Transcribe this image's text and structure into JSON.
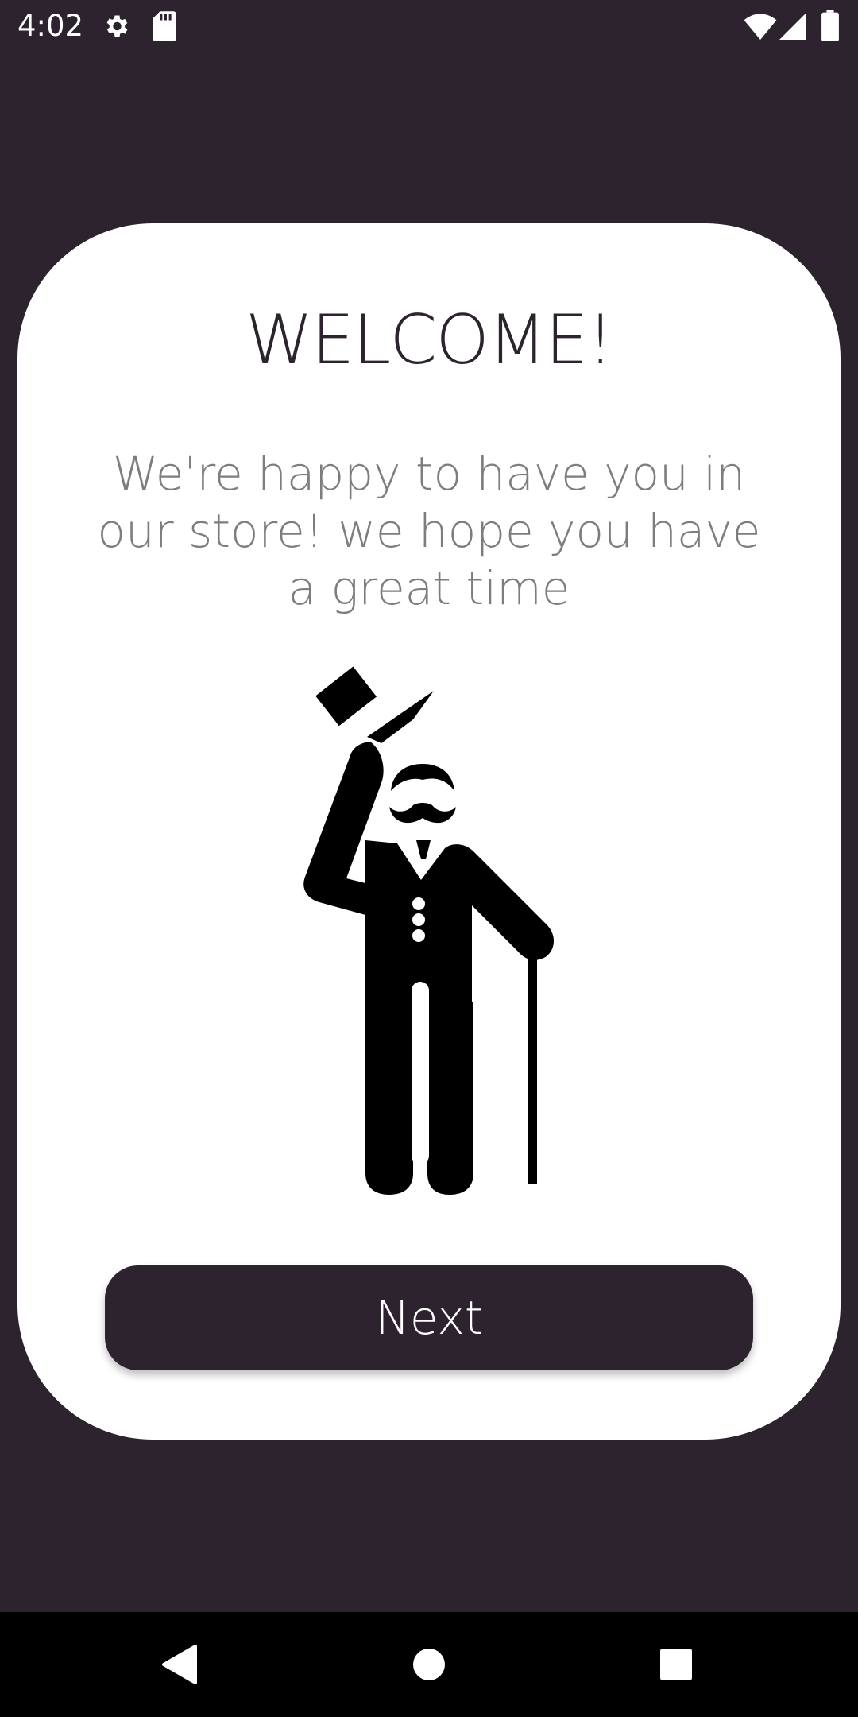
{
  "status_bar": {
    "time": "4:02",
    "icons": [
      "gear-icon",
      "sd-card-icon",
      "wifi-icon",
      "signal-icon",
      "battery-icon"
    ]
  },
  "welcome": {
    "title": "WELCOME!",
    "message": "We're happy to have you in our store! we hope you have a great time",
    "illustration": "gentleman-tipping-hat-icon"
  },
  "actions": {
    "next_label": "Next"
  },
  "nav_bar": {
    "icons": [
      "back-icon",
      "home-icon",
      "recents-icon"
    ]
  },
  "colors": {
    "background": "#2d232f",
    "card": "#ffffff",
    "button": "#2d232f",
    "subtitle_text": "#7d7d7d"
  }
}
